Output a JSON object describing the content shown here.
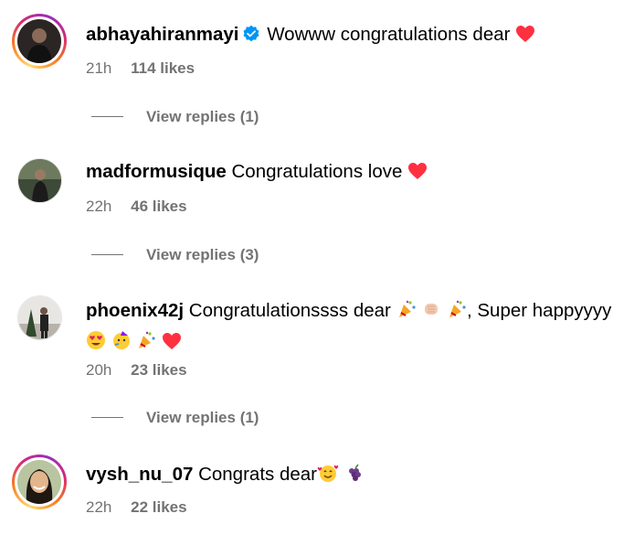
{
  "comments": [
    {
      "username": "abhayahiranmayi",
      "verified": true,
      "text": "Wowww congratulations dear",
      "time": "21h",
      "likes": "114 likes",
      "replies": "View replies (1)",
      "story_ring": true
    },
    {
      "username": "madformusique",
      "verified": false,
      "text": "Congratulations love",
      "time": "22h",
      "likes": "46 likes",
      "replies": "View replies (3)",
      "story_ring": false
    },
    {
      "username": "phoenix42j",
      "verified": false,
      "text": "Congratulationssss dear",
      "text_after": ", Super happyyyy",
      "time": "20h",
      "likes": "23 likes",
      "replies": "View replies (1)",
      "story_ring": false
    },
    {
      "username": "vysh_nu_07",
      "verified": false,
      "text": "Congrats dear",
      "time": "22h",
      "likes": "22 likes",
      "story_ring": true
    }
  ],
  "colors": {
    "meta_text": "#737373",
    "verified_badge": "#0095f6",
    "heart": "#ff3040"
  }
}
